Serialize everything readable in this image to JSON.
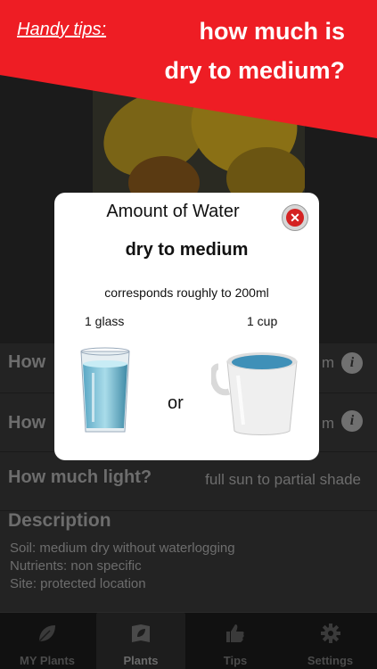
{
  "banner": {
    "tips_label": "Handy tips:",
    "question_line1": "how much is",
    "question_line2": "dry to medium?",
    "color": "#ee1d24"
  },
  "rows": [
    {
      "label": "How",
      "value": "m",
      "icon": "info-icon"
    },
    {
      "label": "How",
      "value": "m",
      "icon": "info-icon"
    },
    {
      "label": "How much light?",
      "value": "full sun to partial shade"
    }
  ],
  "description": {
    "heading": "Description",
    "lines": [
      "Soil: medium dry without waterlogging",
      "Nutrients: non specific",
      "Site: protected location"
    ]
  },
  "tabbar": {
    "tabs": [
      {
        "label": "MY Plants",
        "icon": "leaf-icon"
      },
      {
        "label": "Plants",
        "icon": "plant-book-icon",
        "active": true
      },
      {
        "label": "Tips",
        "icon": "thumbs-up-icon"
      },
      {
        "label": "Settings",
        "icon": "gear-icon"
      }
    ]
  },
  "modal": {
    "title": "Amount of Water",
    "value": "dry to medium",
    "corresponds": "corresponds roughly to 200ml",
    "glass_label": "1 glass",
    "cup_label": "1 cup",
    "or_label": "or",
    "close_icon": "close-icon",
    "close_color": "#d42222"
  }
}
